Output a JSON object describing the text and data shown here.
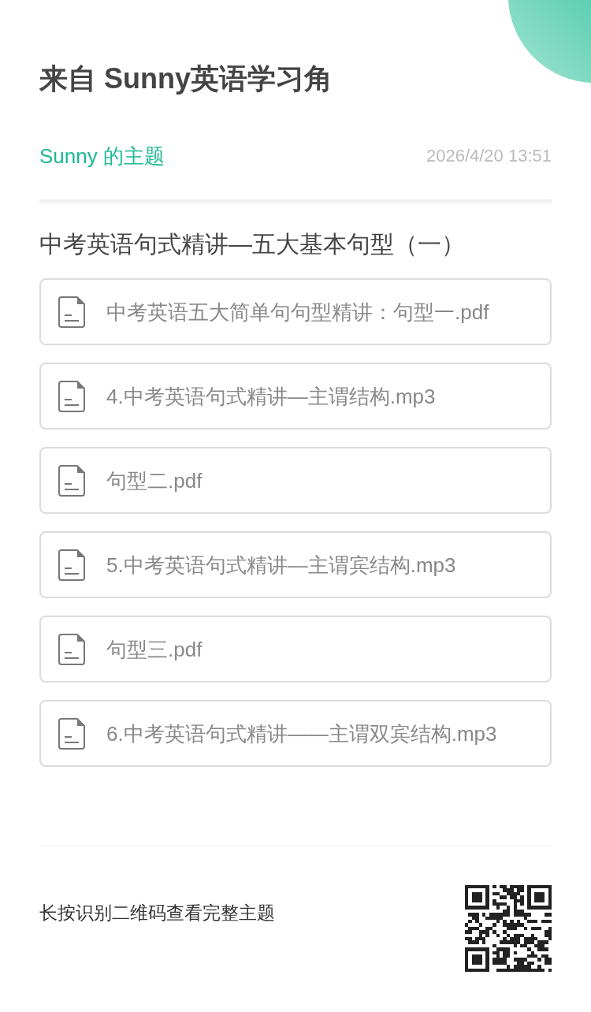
{
  "header": {
    "title": "来自 Sunny英语学习角"
  },
  "meta": {
    "author": "Sunny 的主题",
    "date": "2026/4/20 13:51"
  },
  "topic": {
    "title": "中考英语句式精讲—五大基本句型（一）",
    "files": [
      {
        "name": "中考英语五大简单句句型精讲：句型一.pdf"
      },
      {
        "name": "4.中考英语句式精讲—主谓结构.mp3"
      },
      {
        "name": "句型二.pdf"
      },
      {
        "name": "5.中考英语句式精讲—主谓宾结构.mp3"
      },
      {
        "name": "句型三.pdf"
      },
      {
        "name": "6.中考英语句式精讲——主谓双宾结构.mp3"
      }
    ]
  },
  "footer": {
    "hint": "长按识别二维码查看完整主题"
  }
}
